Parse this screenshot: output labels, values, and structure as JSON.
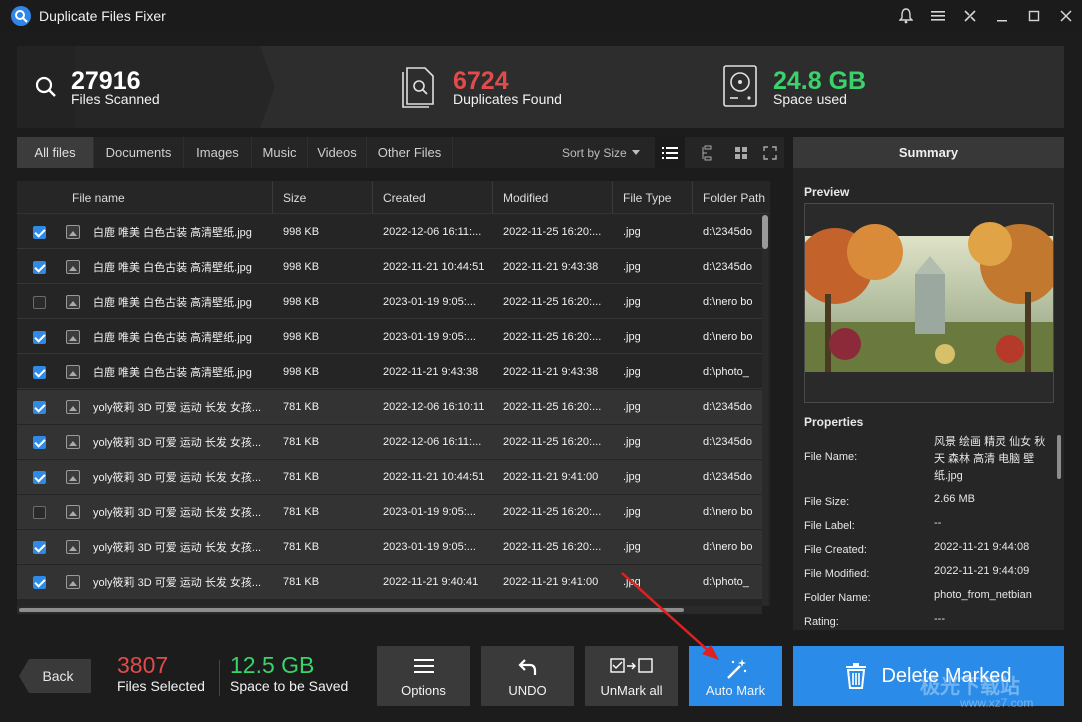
{
  "app": {
    "title": "Duplicate Files Fixer"
  },
  "stats": {
    "scanned_count": "27916",
    "scanned_label": "Files Scanned",
    "duplicates_count": "6724",
    "duplicates_label": "Duplicates Found",
    "space_count": "24.8 GB",
    "space_label": "Space used",
    "colors": {
      "scanned": "#ffffff",
      "duplicates": "#e24b4b",
      "space": "#39d36b"
    }
  },
  "tabs": [
    "All files",
    "Documents",
    "Images",
    "Music",
    "Videos",
    "Other Files"
  ],
  "active_tab": "All files",
  "sort": {
    "label": "Sort by Size"
  },
  "columns": [
    "File name",
    "Size",
    "Created",
    "Modified",
    "File Type",
    "Folder Path"
  ],
  "rows": [
    {
      "checked": true,
      "group": 0,
      "name": "白鹿 唯美 白色古装 高清壁纸.jpg",
      "size": "998 KB",
      "created": "2022-12-06 16:11:...",
      "modified": "2022-11-25 16:20:...",
      "type": ".jpg",
      "path": "d:\\2345do"
    },
    {
      "checked": true,
      "group": 0,
      "name": "白鹿 唯美 白色古装 高清壁纸.jpg",
      "size": "998 KB",
      "created": "2022-11-21 10:44:51",
      "modified": "2022-11-21 9:43:38",
      "type": ".jpg",
      "path": "d:\\2345do"
    },
    {
      "checked": false,
      "group": 0,
      "name": "白鹿 唯美 白色古装 高清壁纸.jpg",
      "size": "998 KB",
      "created": "2023-01-19 9:05:...",
      "modified": "2022-11-25 16:20:...",
      "type": ".jpg",
      "path": "d:\\nero bo"
    },
    {
      "checked": true,
      "group": 0,
      "name": "白鹿 唯美 白色古装 高清壁纸.jpg",
      "size": "998 KB",
      "created": "2023-01-19 9:05:...",
      "modified": "2022-11-25 16:20:...",
      "type": ".jpg",
      "path": "d:\\nero bo"
    },
    {
      "checked": true,
      "group": 0,
      "name": "白鹿 唯美 白色古装 高清壁纸.jpg",
      "size": "998 KB",
      "created": "2022-11-21 9:43:38",
      "modified": "2022-11-21 9:43:38",
      "type": ".jpg",
      "path": "d:\\photo_"
    },
    {
      "checked": true,
      "group": 1,
      "name": "yoly筱莉 3D 可爱 运动 长发 女孩...",
      "size": "781 KB",
      "created": "2022-12-06 16:10:11",
      "modified": "2022-11-25 16:20:...",
      "type": ".jpg",
      "path": "d:\\2345do"
    },
    {
      "checked": true,
      "group": 1,
      "name": "yoly筱莉 3D 可爱 运动 长发 女孩...",
      "size": "781 KB",
      "created": "2022-12-06 16:11:...",
      "modified": "2022-11-25 16:20:...",
      "type": ".jpg",
      "path": "d:\\2345do"
    },
    {
      "checked": true,
      "group": 1,
      "name": "yoly筱莉 3D 可爱 运动 长发 女孩...",
      "size": "781 KB",
      "created": "2022-11-21 10:44:51",
      "modified": "2022-11-21 9:41:00",
      "type": ".jpg",
      "path": "d:\\2345do"
    },
    {
      "checked": false,
      "group": 1,
      "name": "yoly筱莉 3D 可爱 运动 长发 女孩...",
      "size": "781 KB",
      "created": "2023-01-19 9:05:...",
      "modified": "2022-11-25 16:20:...",
      "type": ".jpg",
      "path": "d:\\nero bo"
    },
    {
      "checked": true,
      "group": 1,
      "name": "yoly筱莉 3D 可爱 运动 长发 女孩...",
      "size": "781 KB",
      "created": "2023-01-19 9:05:...",
      "modified": "2022-11-25 16:20:...",
      "type": ".jpg",
      "path": "d:\\nero bo"
    },
    {
      "checked": true,
      "group": 1,
      "name": "yoly筱莉 3D 可爱 运动 长发 女孩...",
      "size": "781 KB",
      "created": "2022-11-21 9:40:41",
      "modified": "2022-11-21 9:41:00",
      "type": ".jpg",
      "path": "d:\\photo_"
    }
  ],
  "summary": {
    "title": "Summary",
    "preview_label": "Preview",
    "properties_label": "Properties",
    "props": [
      {
        "label": "File Name:",
        "value": "风景 绘画 精灵 仙女 秋天 森林 高清 电脑 壁纸.jpg"
      },
      {
        "label": "File Size:",
        "value": "2.66 MB"
      },
      {
        "label": "File Label:",
        "value": "--"
      },
      {
        "label": "File Created:",
        "value": "2022-11-21 9:44:08"
      },
      {
        "label": "File Modified:",
        "value": "2022-11-21 9:44:09"
      },
      {
        "label": "Folder Name:",
        "value": "photo_from_netbian"
      },
      {
        "label": "Rating:",
        "value": "---"
      }
    ]
  },
  "bottom": {
    "back": "Back",
    "files_selected_count": "3807",
    "files_selected_label": "Files Selected",
    "space_saved_count": "12.5 GB",
    "space_saved_label": "Space to be Saved",
    "options": "Options",
    "undo": "UNDO",
    "unmark_all": "UnMark all",
    "auto_mark": "Auto Mark",
    "delete_marked": "Delete Marked"
  },
  "watermark": {
    "text": "极光下载站",
    "url": "www.xz7.com"
  },
  "colors": {
    "accent": "#2a8ce8",
    "red": "#e24b4b",
    "green": "#39d36b",
    "panel": "#2d2d2d"
  }
}
